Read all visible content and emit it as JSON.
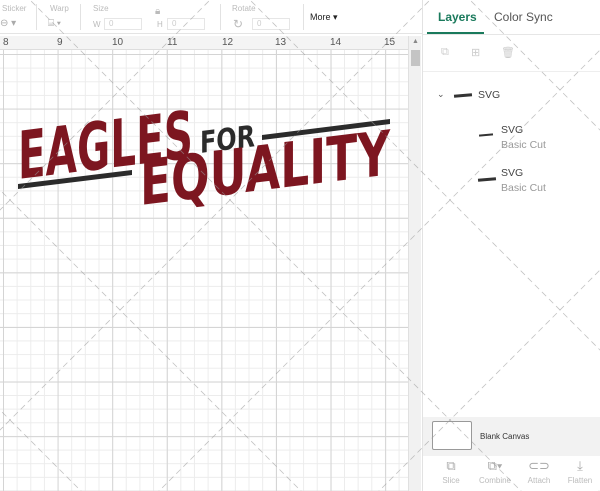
{
  "toolbar": {
    "sticker_label": "Sticker",
    "warp_label": "Warp",
    "size_label": "Size",
    "width_label": "W",
    "width_value": "0",
    "height_label": "H",
    "height_value": "0",
    "rotate_label": "Rotate",
    "rotate_value": "0",
    "more_label": "More"
  },
  "ruler": {
    "labels": [
      "8",
      "9",
      "10",
      "11",
      "12",
      "13",
      "14",
      "15"
    ]
  },
  "design": {
    "word1": "EAGLES",
    "word2": "FOR",
    "word3": "EQUALITY",
    "primary_color": "#7d1620",
    "secondary_color": "#2b2b2b"
  },
  "panel": {
    "tabs": [
      {
        "label": "Layers",
        "active": true
      },
      {
        "label": "Color Sync",
        "active": false
      }
    ],
    "layers": {
      "group": {
        "name": "SVG"
      },
      "children": [
        {
          "name": "SVG",
          "type": "Basic Cut"
        },
        {
          "name": "SVG",
          "type": "Basic Cut"
        }
      ]
    },
    "blank_canvas_label": "Blank Canvas",
    "tools": [
      {
        "label": "Slice",
        "icon": "slice-icon"
      },
      {
        "label": "Combine",
        "icon": "combine-icon"
      },
      {
        "label": "Attach",
        "icon": "attach-icon"
      },
      {
        "label": "Flatten",
        "icon": "flatten-icon"
      }
    ]
  },
  "accent_color": "#1a7a5c"
}
